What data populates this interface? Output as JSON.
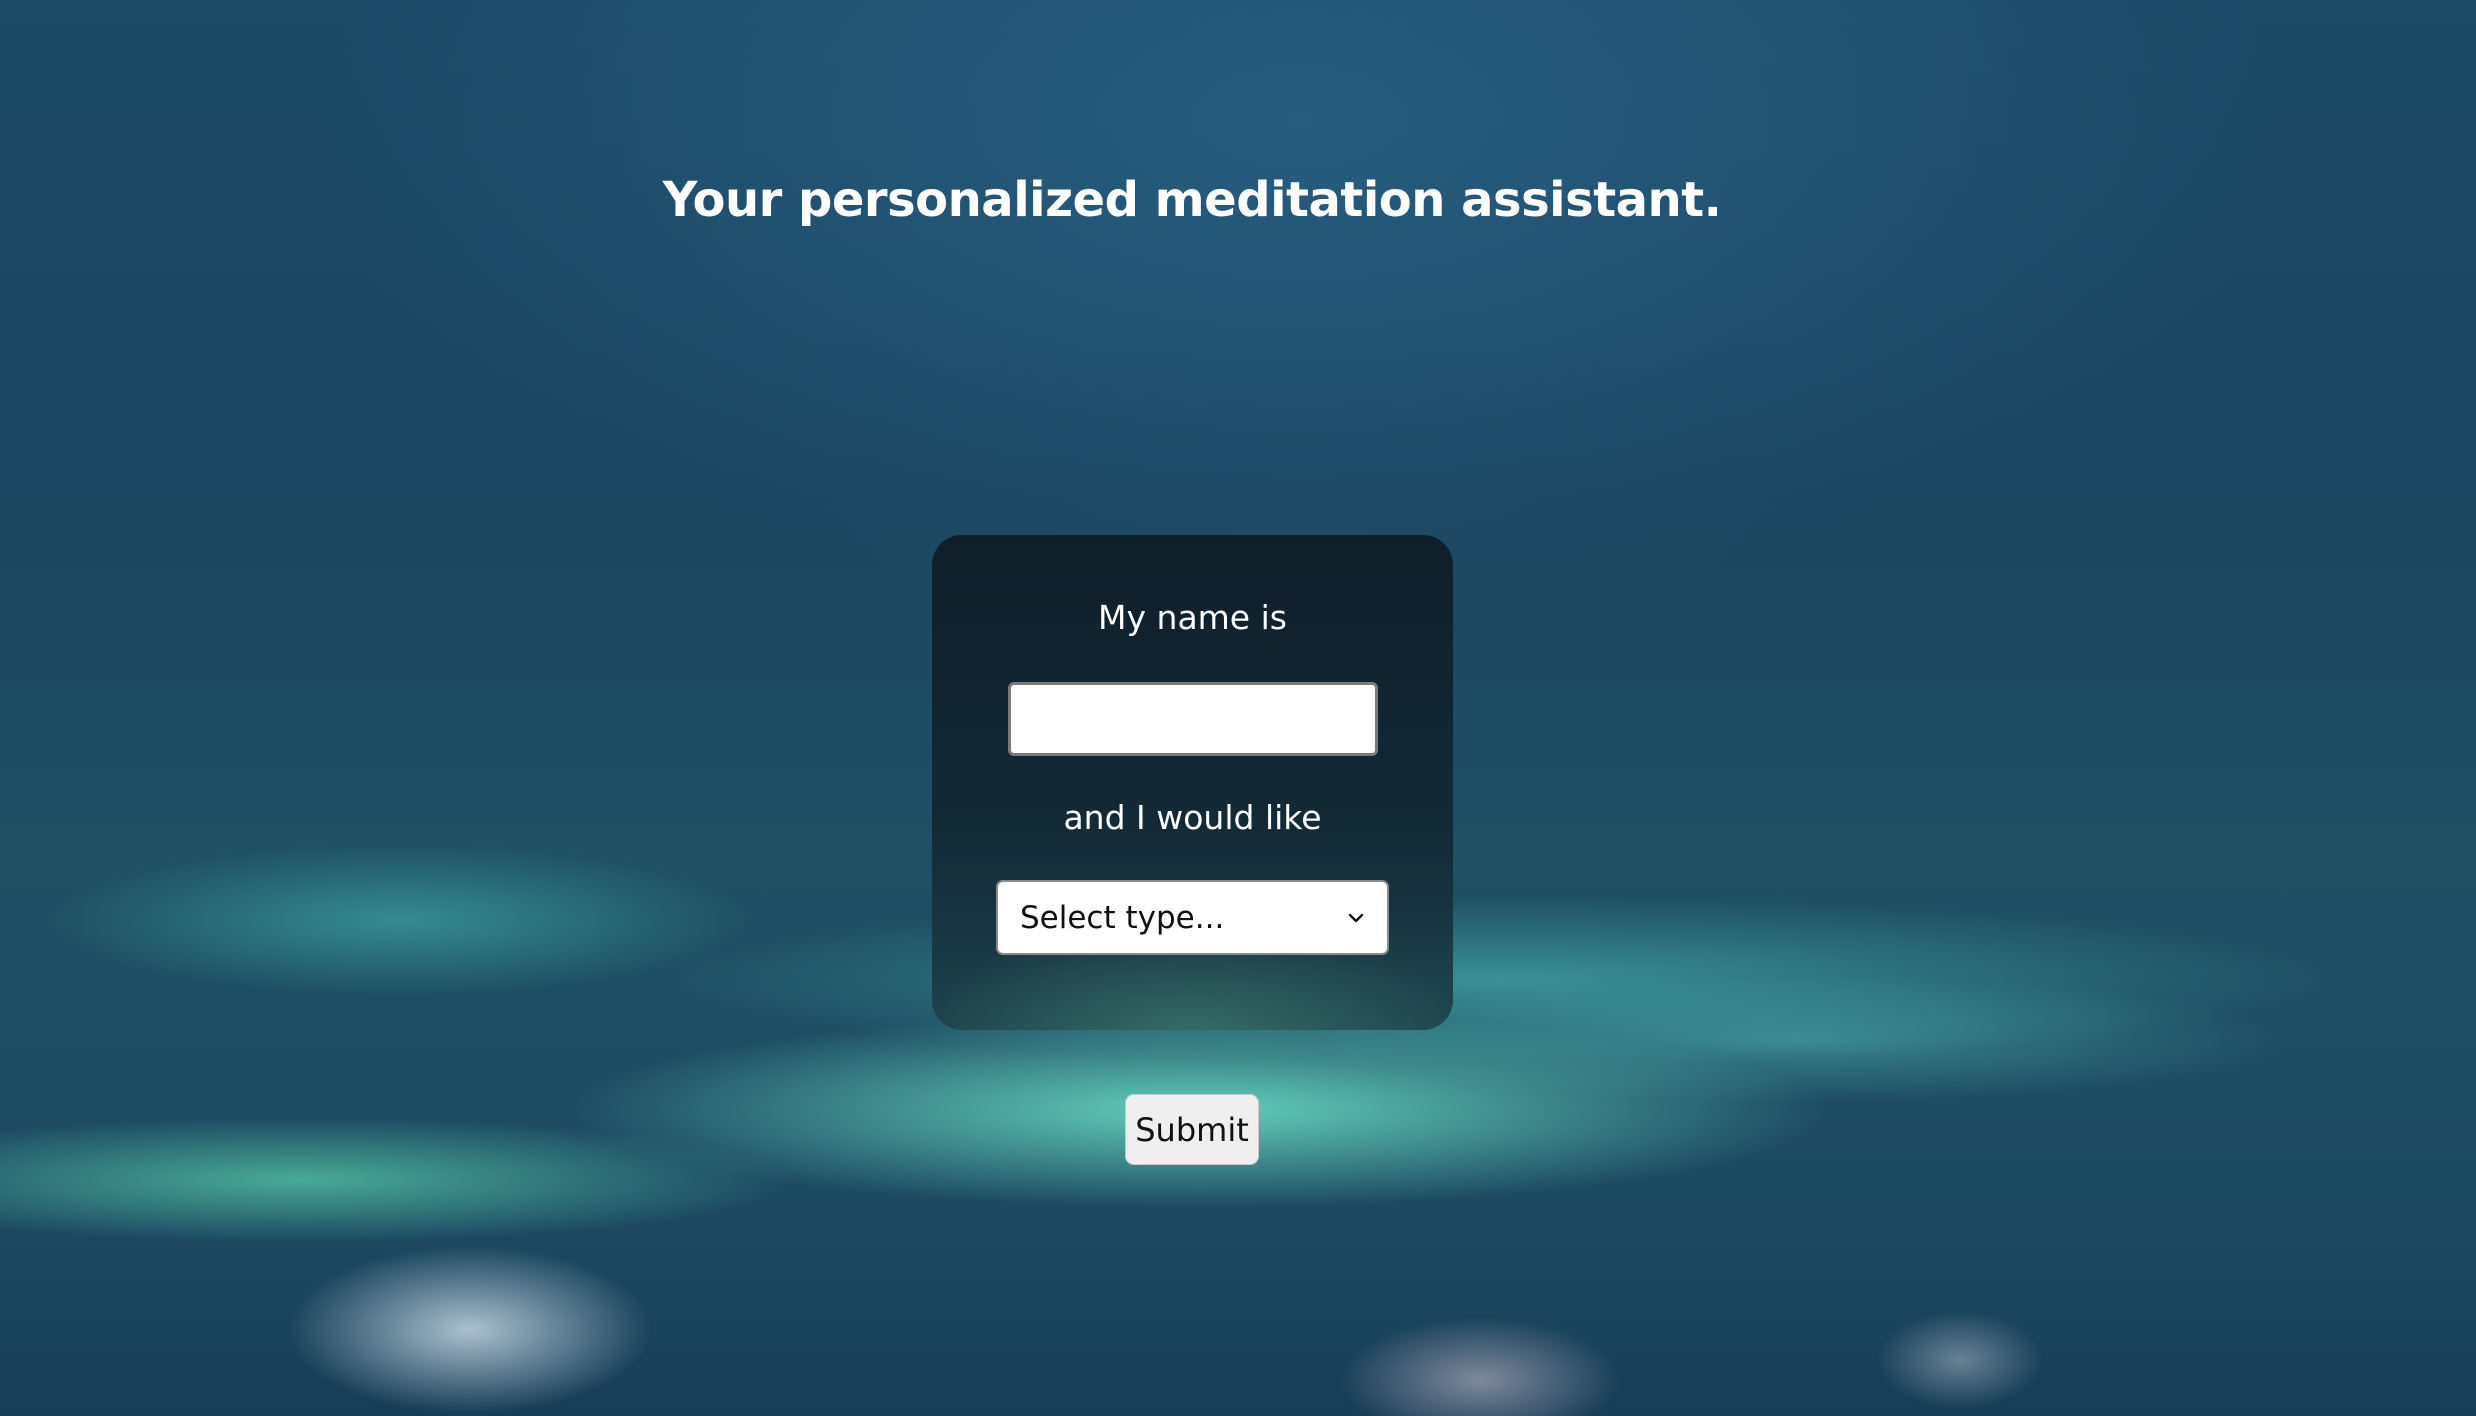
{
  "page": {
    "title": "Your personalized meditation assistant."
  },
  "form": {
    "name_label": "My name is",
    "name_value": "",
    "name_placeholder": "",
    "type_label": "and I would like",
    "type_select": {
      "selected": "Select type...",
      "icon": "chevron-down-icon"
    },
    "submit_label": "Submit"
  },
  "colors": {
    "title_text": "#ffffff",
    "card_background": "#12262f",
    "button_background": "#efefef"
  }
}
